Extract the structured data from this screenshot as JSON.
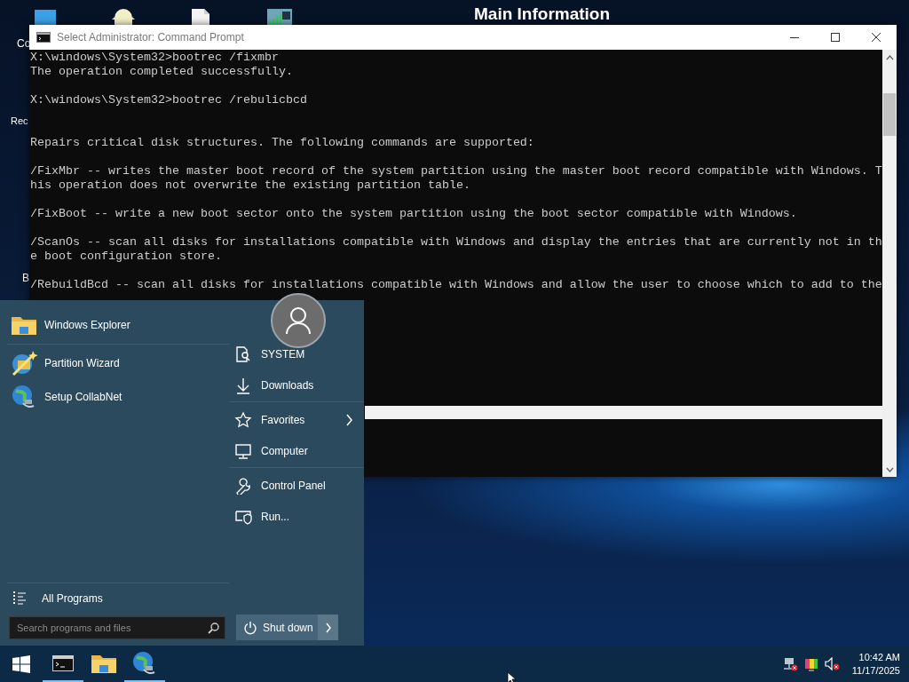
{
  "desktop": {
    "heading": "Main Information",
    "icon_labels": [
      "Co",
      "Rec",
      "B"
    ]
  },
  "console_window": {
    "title": "Select Administrator: Command Prompt",
    "blocks": [
      {
        "kind": "command",
        "lines": [
          "X:\\windows\\System32>bootrec /fixmbr"
        ]
      },
      {
        "kind": "result",
        "lines": [
          "The operation completed successfully."
        ]
      },
      {
        "kind": "command",
        "lines": [
          "X:\\windows\\System32>bootrec /rebulicbcd"
        ]
      },
      {
        "kind": "usage",
        "lines": [
          "Repairs critical disk structures. The following commands are supported:"
        ]
      },
      {
        "kind": "option",
        "lines": [
          "/FixMbr -- writes the master boot record of the system partition using the master boot record compatible with Windows. T",
          "his operation does not overwrite the existing partition table."
        ]
      },
      {
        "kind": "option",
        "lines": [
          "/FixBoot -- write a new boot sector onto the system partition using the boot sector compatible with Windows."
        ]
      },
      {
        "kind": "option",
        "lines": [
          "/ScanOs -- scan all disks for installations compatible with Windows and display the entries that are currently not in th",
          "e boot configuration store."
        ]
      },
      {
        "kind": "option",
        "lines": [
          "/RebuildBcd -- scan all disks for installations compatible with Windows and allow the user to choose which to add to the"
        ]
      }
    ]
  },
  "start_menu": {
    "pinned": [
      {
        "label": "Windows Explorer",
        "kind": "folder"
      }
    ],
    "recent": [
      {
        "label": "Partition Wizard",
        "kind": "wizard"
      },
      {
        "label": "Setup CollabNet",
        "kind": "globe"
      }
    ],
    "all_programs": "All Programs",
    "search": {
      "placeholder": "Search programs and files"
    },
    "place_groups": [
      [
        {
          "label": "SYSTEM",
          "kind": "user",
          "submenu": false
        },
        {
          "label": "Downloads",
          "kind": "download",
          "submenu": false
        }
      ],
      [
        {
          "label": "Favorites",
          "kind": "star",
          "submenu": true
        },
        {
          "label": "Computer",
          "kind": "monitor",
          "submenu": false
        }
      ],
      [
        {
          "label": "Control Panel",
          "kind": "wrench",
          "submenu": false
        },
        {
          "label": "Run...",
          "kind": "run",
          "submenu": false
        }
      ]
    ],
    "shutdown": "Shut down"
  },
  "taskbar": {
    "apps": [
      {
        "kind": "console",
        "running": true
      },
      {
        "kind": "folder",
        "running": false
      },
      {
        "kind": "globe",
        "running": true
      }
    ],
    "clock": {
      "time": "10:42 AM",
      "date": "11/17/2025"
    }
  }
}
